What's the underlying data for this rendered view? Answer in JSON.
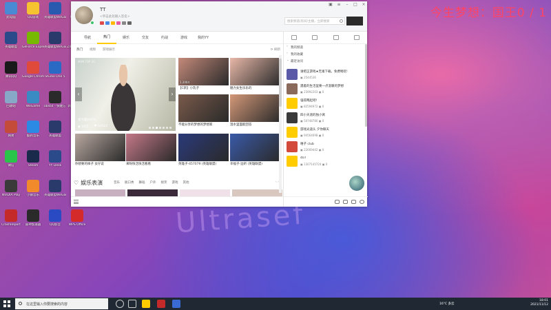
{
  "overlay_text": "今生梦想：国王0 / 1",
  "watermark_text": "Ultrasef",
  "desktop_icons": [
    {
      "label": "此电脑",
      "color": "#4a8ad4"
    },
    {
      "label": "QQ游戏",
      "color": "#f5c230"
    },
    {
      "label": "英雄联盟WeGame",
      "color": "#2a5ab0"
    },
    {
      "label": "WeGame",
      "color": "#3a7ad4"
    },
    {
      "label": "英雄联盟",
      "color": "#2a4a8a"
    },
    {
      "label": "GeForce Experience",
      "color": "#76b900"
    },
    {
      "label": "英雄联盟WeGame版",
      "color": "#2a3a6a"
    },
    {
      "label": "ZXA716-16...",
      "color": "#6a6a6a"
    },
    {
      "label": "腾讯QQ",
      "color": "#1a1a1a"
    },
    {
      "label": "Google Chrome",
      "color": "#e04a3a"
    },
    {
      "label": "Studio One 5",
      "color": "#2a6ac4"
    },
    {
      "label": "QQ游戏",
      "color": "#3a3a3a"
    },
    {
      "label": "回收站",
      "color": "#88a8c8"
    },
    {
      "label": "WeGame",
      "color": "#3a8ac4"
    },
    {
      "label": "obs64 - 快捷方式",
      "color": "#2a2a2a"
    },
    {
      "label": "新建文本文档",
      "color": "#e8e8e8"
    },
    {
      "label": "网易",
      "color": "#c44a3a"
    },
    {
      "label": "酷狗音乐",
      "color": "#2a8ae4"
    },
    {
      "label": "英雄联盟",
      "color": "#2a3a6a"
    },
    {
      "label": "YY语音",
      "color": "#ffcc00"
    },
    {
      "label": "微信",
      "color": "#2ac44a"
    },
    {
      "label": "Steam",
      "color": "#1a2a4a"
    },
    {
      "label": "YY Desk",
      "color": "#2a4a8a"
    },
    {
      "label": "YY开播",
      "color": "#ffcc00"
    },
    {
      "label": "NVIDIA Play",
      "color": "#3a3a3a"
    },
    {
      "label": "小鹅音乐",
      "color": "#f08a2a"
    },
    {
      "label": "英雄联盟WeGame版",
      "color": "#2a3a6a"
    },
    {
      "label": "QQ音乐",
      "color": "#f0c02a"
    },
    {
      "label": "CrashReport",
      "color": "#c42a2a"
    },
    {
      "label": "雷神加速器",
      "color": "#2a2a2a"
    },
    {
      "label": "QQ影音",
      "color": "#2a4ac4"
    },
    {
      "label": "WPS Office",
      "color": "#d42a2a"
    }
  ],
  "window": {
    "nickname": "TT",
    "signature": "<单击此处输入签名>",
    "search_placeholder": "搜索频道/房间/主播，立即搜索",
    "tabs": [
      "导航",
      "热门",
      "娱乐",
      "交友",
      "约战",
      "游戏",
      "我的YY"
    ],
    "active_tab": 1,
    "subtabs": [
      "热门",
      "视频",
      "游戏展示"
    ],
    "active_subtab": 0,
    "refresh_label": "刷新",
    "banner": {
      "tag": "MAN TOP 30",
      "name": "金大腿(HOT)",
      "viewers": "19万",
      "likes": "64922"
    },
    "cards": [
      {
        "caption": "【C新】小乳子",
        "tag": "1.2004",
        "color": "#c48a7a"
      },
      {
        "caption": "魅力女生乐乐的",
        "tag": "",
        "color": "#e8b8a8"
      },
      {
        "caption": "不能分享的梦想的梦想家",
        "tag": "",
        "color": "#7a5a4a"
      },
      {
        "caption": "温水里面能回答",
        "tag": "",
        "color": "#d49878"
      },
      {
        "caption": "你想要的样子 女仔说",
        "tag": "",
        "color": "#b8a8a0"
      },
      {
        "caption": "来呀快活快活看看",
        "tag": "",
        "color": "#c47888"
      },
      {
        "caption": "英雄子-457079 (英雄联盟)",
        "tag": "",
        "color": "#2a3a7a"
      },
      {
        "caption": "幸福子-边听 (英雄联盟)",
        "tag": "",
        "color": "#3a5aa8"
      }
    ],
    "section_title": "娱乐表演",
    "section_tags": [
      "音乐",
      "脱口秀",
      "舞蹈",
      "户外",
      "搞笑",
      "游戏",
      "其他"
    ],
    "right_panel": {
      "groups": [
        {
          "label": "我的频道",
          "open": false
        },
        {
          "label": "我的收藏",
          "open": false
        },
        {
          "label": "最近访问",
          "open": true
        }
      ],
      "items": [
        {
          "name": "请把正游戏★无毒下载，免费畅玩!",
          "id": "2544536",
          "count": "",
          "color": "#5a5aa8"
        },
        {
          "name": "遇着的生活里要一点温暖的梦想",
          "id": "23992203",
          "count": "0",
          "color": "#8a6a5a"
        },
        {
          "name": "强得两起吧!",
          "id": "82594972",
          "count": "0",
          "color": "#ffcc00"
        },
        {
          "name": "四小天道的独小窝",
          "id": "50748780",
          "count": "0",
          "color": "#3a3a3a"
        },
        {
          "name": "游戏光道头 夕你聊天",
          "id": "94564698",
          "count": "0",
          "color": "#ffcc00"
        },
        {
          "name": "嘻子 club",
          "id": "22669442",
          "count": "0",
          "color": "#d44a3a"
        },
        {
          "name": "407",
          "id": "1307145724",
          "count": "0",
          "color": "#ffcc00"
        }
      ]
    }
  },
  "taskbar": {
    "search_placeholder": "在这里输入你要搜索的内容",
    "weather": "16°C 多云",
    "time": "18:01",
    "date": "2021/11/12"
  }
}
